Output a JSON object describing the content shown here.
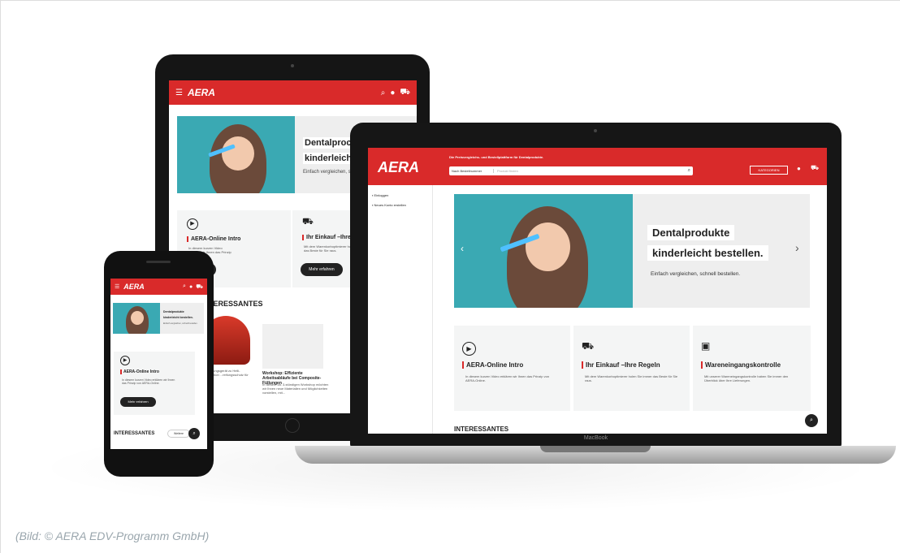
{
  "caption": "(Bild: © AERA EDV-Programm GmbH)",
  "brand": "AERA",
  "laptop": {
    "tagline": "Die Preisvergleichs- und Bestellplattform für Dentalprodukte.",
    "search_select": "Nach Bestellnummer",
    "search_placeholder": "Produkt finden",
    "categories_label": "KATEGORIEN",
    "sidebar": [
      "Einloggen",
      "Neues Konto erstellen"
    ],
    "hero_line1": "Dentalprodukte",
    "hero_line2": "kinderleicht bestellen.",
    "hero_sub": "Einfach vergleichen, schnell bestellen.",
    "cards": [
      {
        "title": "AERA-Online Intro",
        "text": "In diesem kurzen Video erklären wir Ihnen das Prinzip von AERA-Online."
      },
      {
        "title": "Ihr Einkauf –Ihre Regeln",
        "text": "Mit dem Warenkorboptimierer holen Sie immer das Beste für Sie raus."
      },
      {
        "title": "Wareneingangskontrolle",
        "text": "Mit unserer Wareneingangskontrolle haben Sie immer den Überblick über Ihre Lieferungen."
      }
    ],
    "section_title": "INTERESSANTES",
    "brand_label": "MacBook"
  },
  "tablet": {
    "hero_line1": "Dentalproc",
    "hero_line2": "kinderleicht",
    "hero_sub": "Einfach vergleichen, s",
    "card1_title": "AERA-Online Intro",
    "card1_text": "In diesem kurzen Video erklären wir Ihnen das Prinzip",
    "card2_title": "Ihr Einkauf –Ihre Re",
    "card2_text": "Mit dem Warenkorboptimierer holen Sie immer das Beste für Sie raus.",
    "more_label": "Mehr erfahren",
    "section_title": "INTERESSANTES",
    "workshop_title": "Workshop: Effiziente Arbeitsabläufe bei Composite-Füllungen",
    "workshop_text": "In diesem ca. 3-stündigen Workshop möchten wir Ihnen neue Materialien und Möglichkeiten vorstellen, mit...",
    "left_text": "...erdungsgerät zu Helli- ...ntration ...reifungsschutz für 7..."
  },
  "phone": {
    "hero_line1": "Dentalprodukte",
    "hero_line2": "kinderleicht bestellen.",
    "hero_sub": "Einfach vergleichen, schnell bestellen.",
    "card_title": "AERA-Online Intro",
    "card_text": "In diesem kurzen Video erklären wir Ihnen das Prinzip von AERA-Online.",
    "more_label": "Mehr erfahren",
    "section_title": "INTERESSANTES",
    "more_small": "Weitere"
  }
}
